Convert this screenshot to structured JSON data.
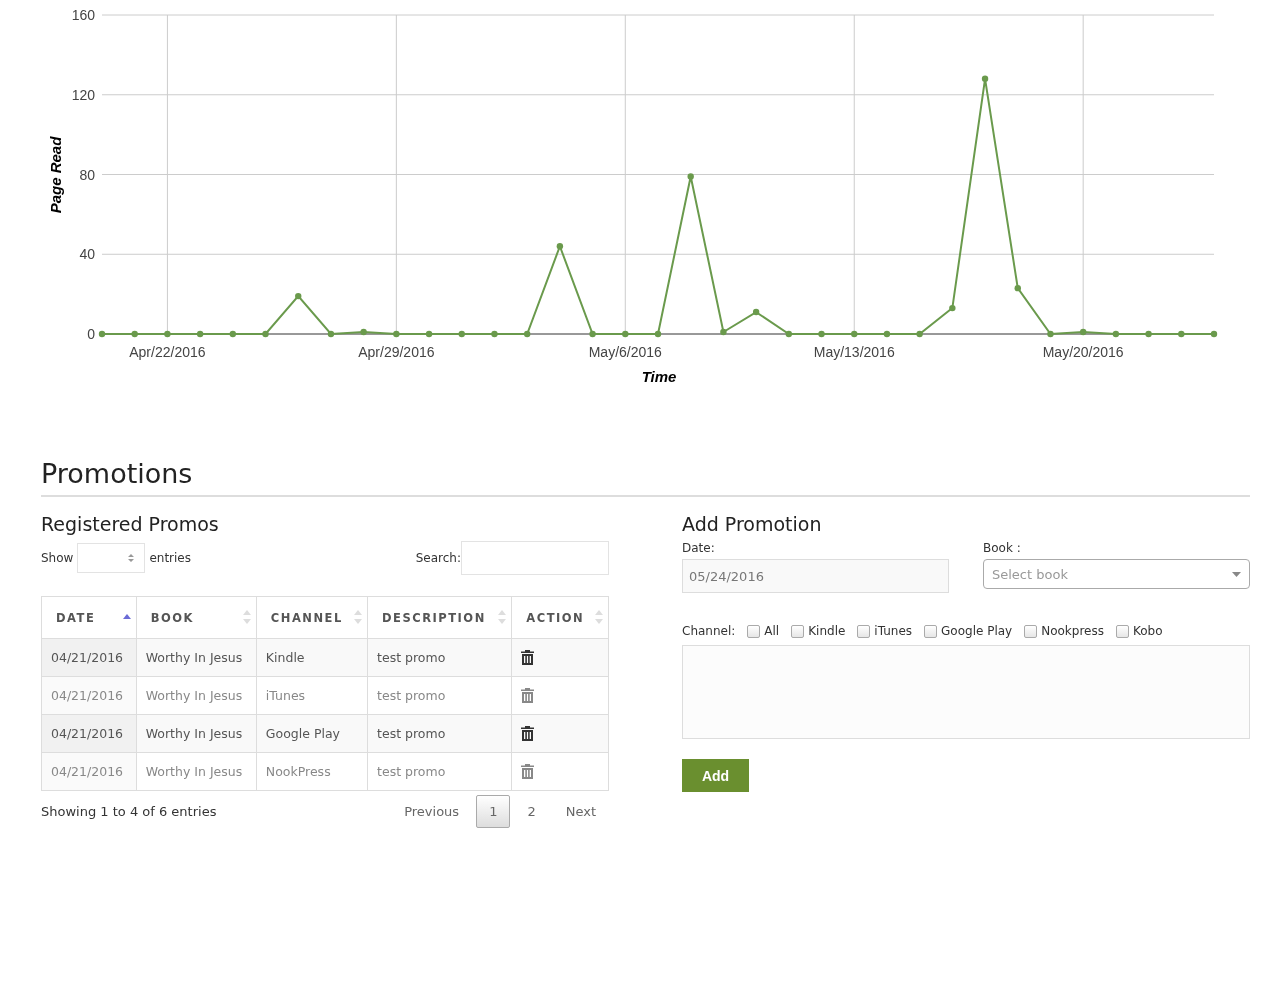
{
  "chart": {
    "chart_data": {
      "type": "line",
      "xlabel": "Time",
      "ylabel": "Page Read",
      "categories": [
        null,
        null,
        "Apr/22/2016",
        null,
        null,
        null,
        null,
        null,
        null,
        "Apr/29/2016",
        null,
        null,
        null,
        null,
        null,
        null,
        "May/6/2016",
        null,
        null,
        null,
        null,
        null,
        null,
        "May/13/2016",
        null,
        null,
        null,
        null,
        null,
        null,
        "May/20/2016",
        null,
        null,
        null,
        null
      ],
      "grid": true,
      "series": [
        {
          "color": "#6a9a4c",
          "marker": true,
          "values": [
            0,
            0,
            0,
            0,
            0,
            0,
            19,
            0,
            1,
            0,
            0,
            0,
            0,
            0,
            44,
            0,
            0,
            0,
            79,
            1,
            11,
            0,
            0,
            0,
            0,
            0,
            13,
            128,
            23,
            0,
            1,
            0,
            0,
            0,
            0
          ]
        }
      ],
      "ylim": [
        0,
        160
      ],
      "yticks": [
        0,
        40,
        80,
        120,
        160
      ]
    }
  },
  "promotions": {
    "title": "Promotions",
    "registered": {
      "title": "Registered Promos",
      "show_label": "Show",
      "entries_label": "entries",
      "search_label": "Search:",
      "columns": [
        {
          "label": "DATE",
          "sorted": true
        },
        {
          "label": "BOOK",
          "sorted": false
        },
        {
          "label": "CHANNEL",
          "sorted": false
        },
        {
          "label": "DESCRIPTION",
          "sorted": false
        },
        {
          "label": "ACTION",
          "sorted": false
        }
      ],
      "rows": [
        {
          "date": "04/21/2016",
          "book": "Worthy In Jesus",
          "channel": "Kindle",
          "description": "test promo"
        },
        {
          "date": "04/21/2016",
          "book": "Worthy In Jesus",
          "channel": "iTunes",
          "description": "test promo"
        },
        {
          "date": "04/21/2016",
          "book": "Worthy In Jesus",
          "channel": "Google Play",
          "description": "test promo"
        },
        {
          "date": "04/21/2016",
          "book": "Worthy In Jesus",
          "channel": "NookPress",
          "description": "test promo"
        }
      ],
      "info": "Showing 1 to 4 of 6 entries",
      "pagination": {
        "previous": "Previous",
        "next": "Next",
        "pages": [
          {
            "label": "1",
            "selected": true
          },
          {
            "label": "2",
            "selected": false
          }
        ]
      }
    },
    "add": {
      "title": "Add Promotion",
      "date_label": "Date:",
      "date_value": "05/24/2016",
      "book_label": "Book :",
      "book_placeholder": "Select book",
      "channel_label": "Channel:",
      "channels": [
        {
          "label": "All",
          "checked": false
        },
        {
          "label": "Kindle",
          "checked": false
        },
        {
          "label": "iTunes",
          "checked": false
        },
        {
          "label": "Google Play",
          "checked": false
        },
        {
          "label": "Nookpress",
          "checked": false
        },
        {
          "label": "Kobo",
          "checked": false
        }
      ],
      "button": "Add"
    }
  }
}
